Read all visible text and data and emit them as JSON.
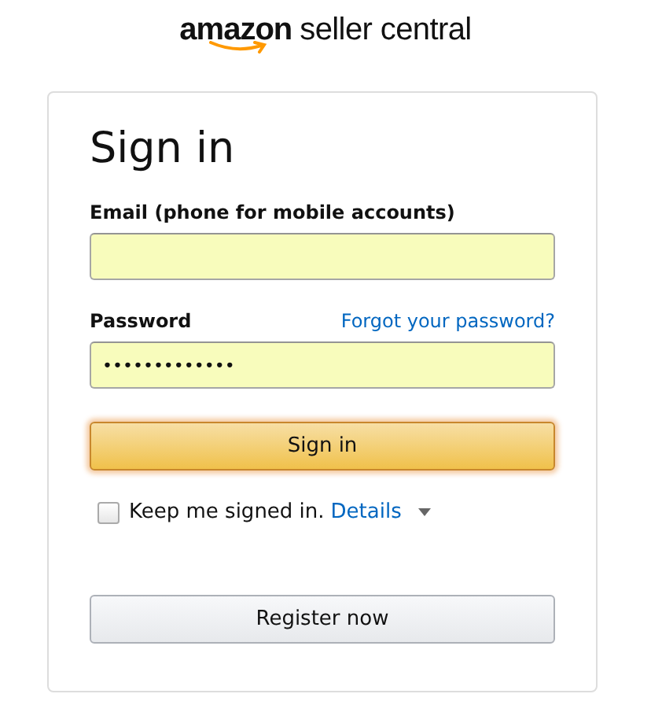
{
  "logo": {
    "brand": "amazon",
    "product": "seller central"
  },
  "title": "Sign in",
  "email": {
    "label": "Email (phone for mobile accounts)"
  },
  "password": {
    "label": "Password",
    "forgot_link": "Forgot your password?",
    "value": "•••••••••••••"
  },
  "sign_in_button": "Sign in",
  "keep_signed_in": {
    "label": "Keep me signed in.",
    "link": "Details",
    "checked": false
  },
  "register_button": "Register now"
}
